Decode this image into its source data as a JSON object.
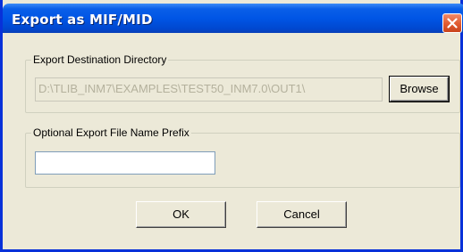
{
  "window": {
    "title": "Export as MIF/MID"
  },
  "destination": {
    "legend": "Export Destination Directory",
    "path_value": "D:\\TLIB_INM7\\EXAMPLES\\TEST50_INM7.0\\OUT1\\",
    "browse_label": "Browse"
  },
  "prefix": {
    "legend": "Optional Export File Name Prefix",
    "value": ""
  },
  "footer": {
    "ok_label": "OK",
    "cancel_label": "Cancel"
  },
  "icons": {
    "close": "close-icon"
  },
  "colors": {
    "title_bar": "#0055e5",
    "dialog_bg": "#ece9d8",
    "close_button": "#e05a2f"
  }
}
